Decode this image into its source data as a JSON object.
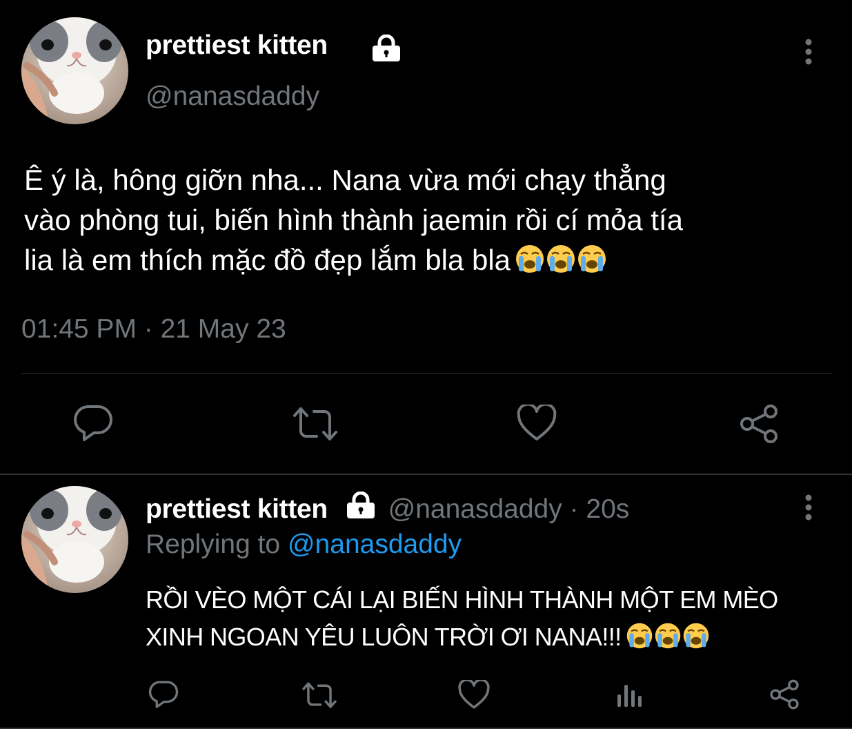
{
  "main_tweet": {
    "display_name": "prettiest kitten",
    "handle": "@nanasdaddy",
    "text_lines": [
      "Ê ý là, hông giỡn nha... Nana vừa mới chạy thẳng",
      "vào phòng tui, biến hình thành jaemin rồi cí mỏa tía",
      "lia là em thích mặc đồ đẹp lắm bla bla"
    ],
    "emoji": "😭😭😭",
    "timestamp": "01:45 PM · 21 May 23",
    "actions": [
      "reply-icon",
      "retweet-icon",
      "like-icon",
      "share-icon"
    ]
  },
  "reply_tweet": {
    "display_name": "prettiest kitten",
    "meta": "@nanasdaddy · 20s",
    "replying_label": "Replying to",
    "replying_to": "@nanasdaddy",
    "text_lines": [
      "RỒI VÈO MỘT CÁI LẠI BIẾN HÌNH THÀNH MỘT EM MÈO",
      "XINH NGOAN YÊU LUÔN TRỜI ƠI NANA!!!"
    ],
    "emoji": "😭😭😭",
    "actions": [
      "reply-icon",
      "retweet-icon",
      "like-icon",
      "analytics-icon",
      "share-icon"
    ]
  },
  "colors": {
    "background": "#000000",
    "text_primary": "#ffffff",
    "text_secondary": "#71767b",
    "link": "#1d9bf0",
    "divider": "#2f3336"
  }
}
